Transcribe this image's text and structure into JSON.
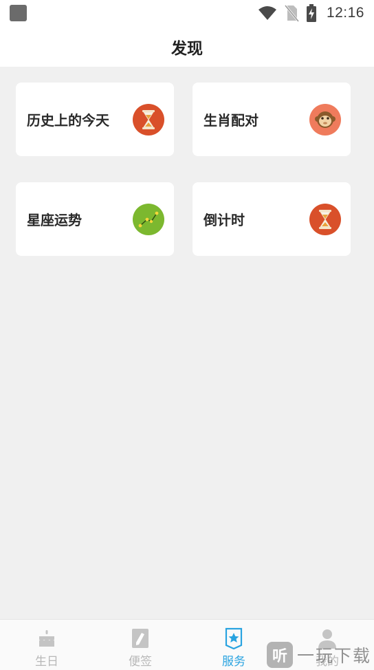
{
  "status_bar": {
    "time": "12:16",
    "icons": [
      "app-notification-icon",
      "wifi-icon",
      "no-sim-icon",
      "battery-charging-icon"
    ]
  },
  "header": {
    "title": "发现"
  },
  "services": [
    {
      "label": "历史上的今天",
      "icon": "hourglass-icon"
    },
    {
      "label": "生肖配对",
      "icon": "monkey-icon"
    },
    {
      "label": "星座运势",
      "icon": "constellation-icon"
    },
    {
      "label": "倒计时",
      "icon": "hourglass-icon"
    }
  ],
  "bottom_nav": {
    "items": [
      {
        "label": "生日",
        "icon": "cake-icon",
        "active": false
      },
      {
        "label": "便签",
        "icon": "note-pen-icon",
        "active": false
      },
      {
        "label": "服务",
        "icon": "star-badge-icon",
        "active": true
      },
      {
        "label": "我的",
        "icon": "person-icon",
        "active": false
      }
    ]
  },
  "watermark": {
    "mark": "听",
    "text": "一玩下载"
  },
  "colors": {
    "accent": "#29a3e0",
    "background": "#f0f0f0",
    "card": "#ffffff",
    "hourglass_bg": "#d9502a",
    "monkey_bg": "#ef7b5c",
    "constellation_bg": "#7cb82f"
  }
}
